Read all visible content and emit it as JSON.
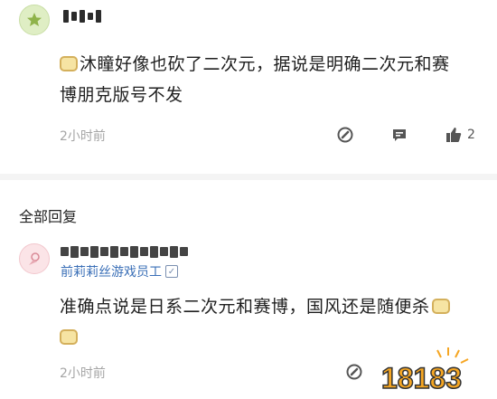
{
  "main_comment": {
    "text_line1": "沐瞳好像也砍了二次元，据说是明确二次元和赛",
    "text_line2": "博朋克版号不发",
    "time": "2小时前",
    "like_count": "2"
  },
  "replies_section": {
    "title": "全部回复"
  },
  "reply": {
    "user_title": "前莉莉丝游戏员工",
    "text_line1": "准确点说是日系二次元和赛博，国风还是随便杀",
    "time": "2小时前"
  },
  "watermark": {
    "text": "18183"
  },
  "colors": {
    "accent_blue": "#3a6fb7",
    "meta_gray": "#a5a5a5",
    "watermark_orange": "#f5a623"
  }
}
